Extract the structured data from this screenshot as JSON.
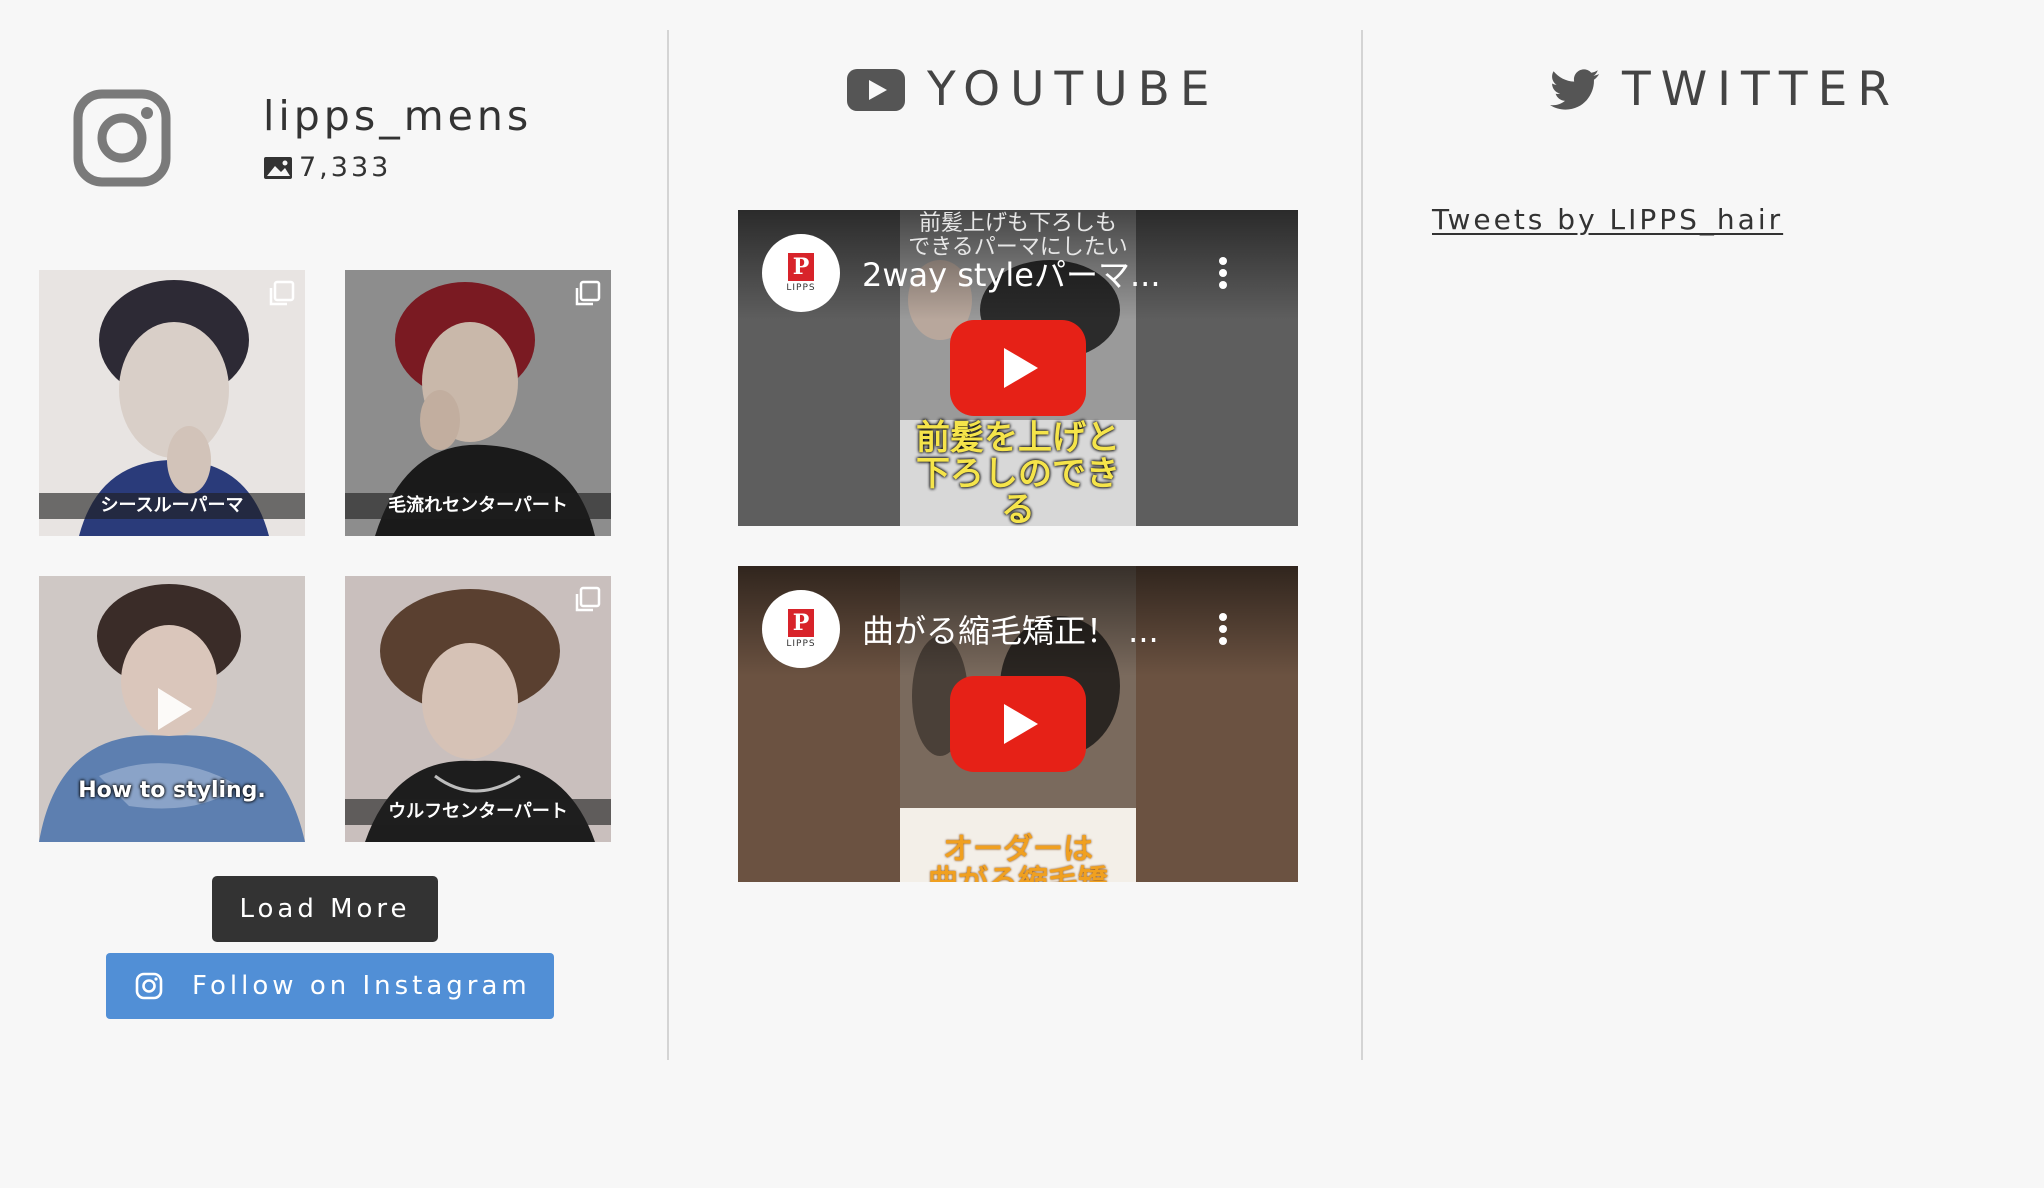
{
  "instagram": {
    "username": "lipps_mens",
    "post_count": "7,333",
    "posts": [
      {
        "caption": "シースルーパーマ",
        "type": "carousel",
        "colors": [
          "#2d2a35",
          "#d9cfc8",
          "#2a3b7a"
        ]
      },
      {
        "caption": "毛流れセンターパート",
        "type": "carousel",
        "colors": [
          "#7a1a22",
          "#c9b8aa",
          "#1a1a1a"
        ]
      },
      {
        "caption": "How to styling.",
        "type": "video",
        "colors": [
          "#3a2c28",
          "#5d7fb0",
          "#cfc8c5"
        ]
      },
      {
        "caption": "ウルフセンターパート",
        "type": "carousel",
        "colors": [
          "#5a4030",
          "#b9a69e",
          "#1d1d1d"
        ]
      }
    ],
    "load_more_label": "Load More",
    "follow_label": "Follow on Instagram"
  },
  "youtube": {
    "heading": "YOUTUBE",
    "videos": [
      {
        "title": "2way styleパーマ...",
        "channel_mark": "P",
        "channel_name": "LIPPS",
        "overlay_top": "前髪上げも下ろしも\nできるパーマにしたい",
        "overlay_bottom": "前髪を上げと\n下ろしのできる",
        "bg": "#5c5c5c"
      },
      {
        "title": "曲がる縮毛矯正！ ...",
        "channel_mark": "P",
        "channel_name": "LIPPS",
        "overlay_top": "",
        "overlay_bottom": "オーダーは\n曲がる縮毛矯正！",
        "bg": "#6b5241"
      }
    ]
  },
  "twitter": {
    "heading": "TWITTER",
    "tweets_link": "Tweets by LIPPS_hair"
  },
  "colors": {
    "follow_button": "#518fd6",
    "load_more": "#333333",
    "youtube_red": "#e62117"
  }
}
